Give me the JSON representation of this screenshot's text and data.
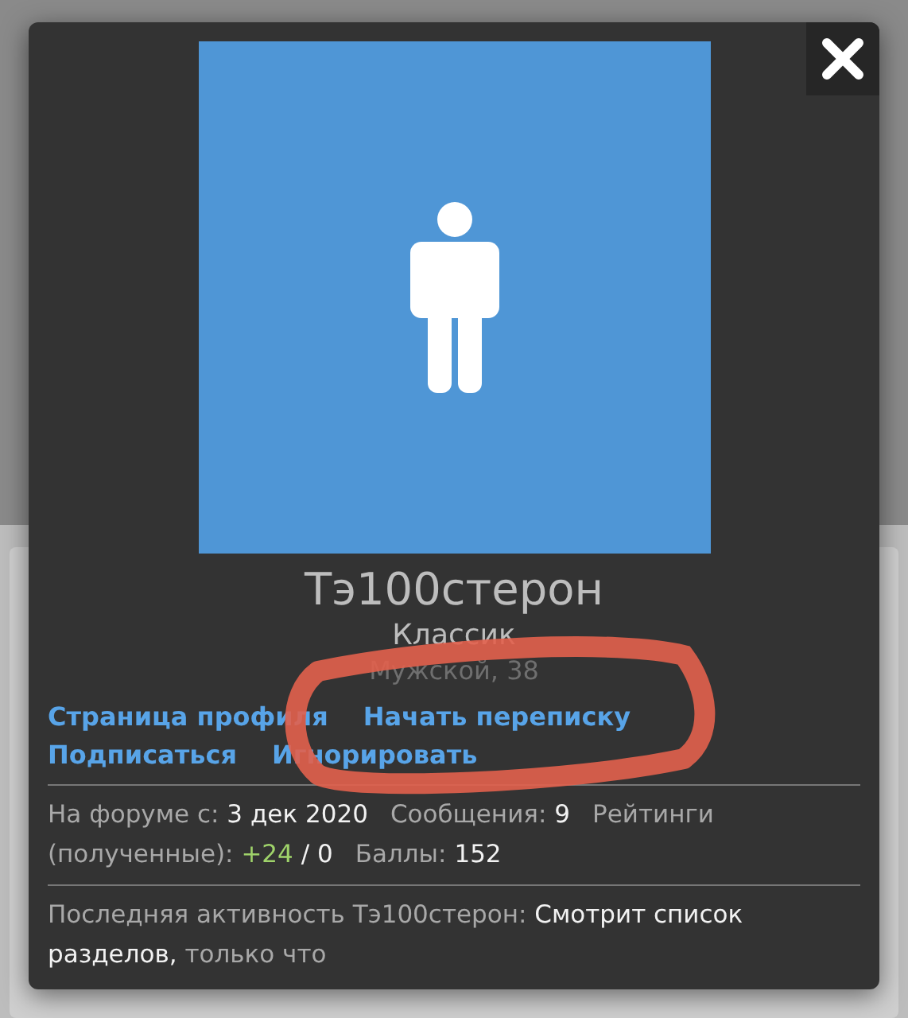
{
  "popup": {
    "username": "Тэ100стерон",
    "title": "Классик",
    "details": "Мужской, 38",
    "links": [
      [
        "Страница профиля",
        "Начать переписку"
      ],
      [
        "Подписаться",
        "Игнорировать"
      ]
    ],
    "stats": [
      {
        "kind": "plain",
        "label": "На форуме с:",
        "value": "3 дек 2020"
      },
      {
        "kind": "plain",
        "label": "Сообщения:",
        "value": "9"
      },
      {
        "kind": "rating",
        "label": "Рейтинги (полученные):",
        "positive": "+24",
        "rest": "/ 0"
      },
      {
        "kind": "plain",
        "label": "Баллы:",
        "value": "152"
      }
    ],
    "activity": {
      "label": "Последняя активность Тэ100стерон:",
      "action": "Смотрит список разделов,",
      "time": "только что"
    }
  }
}
